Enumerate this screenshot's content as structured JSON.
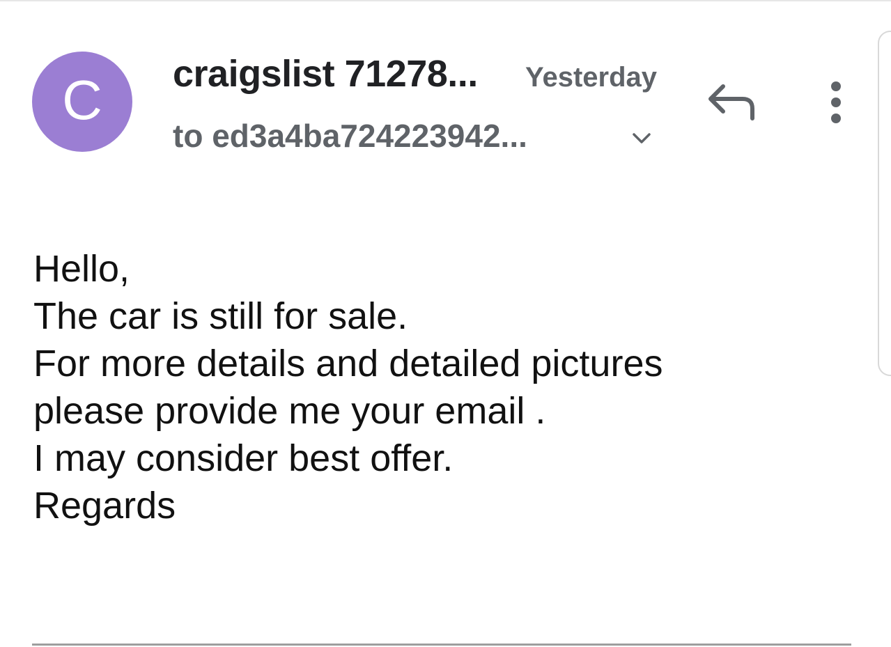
{
  "header": {
    "avatar_letter": "C",
    "avatar_color": "#9b7ed3",
    "sender": "craigslist 71278...",
    "date": "Yesterday",
    "recipient": "to ed3a4ba724223942...",
    "icons": {
      "expand": "chevron-down-icon",
      "reply": "reply-icon",
      "more": "more-vertical-icon"
    }
  },
  "message": {
    "lines": [
      "Hello,",
      "The car is still for sale.",
      "For more details and detailed pictures",
      "please provide me your email .",
      "I may consider best offer.",
      "Regards"
    ]
  }
}
